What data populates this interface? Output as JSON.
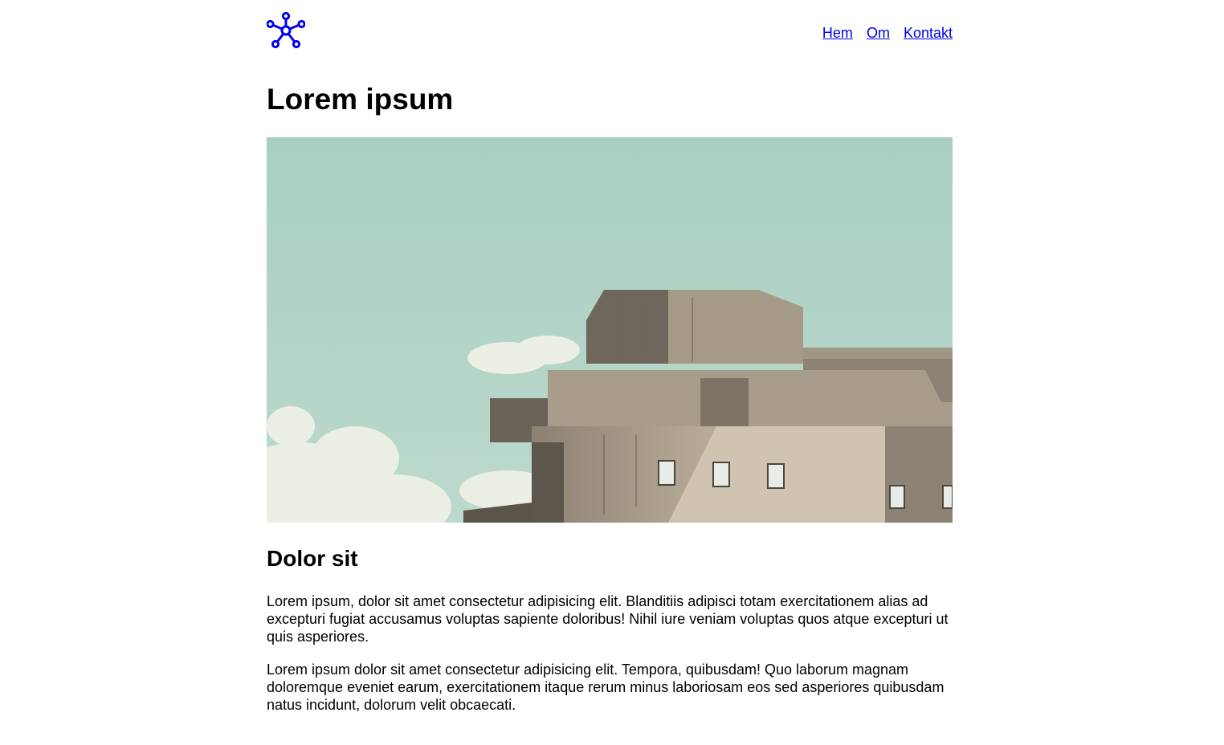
{
  "nav": {
    "items": [
      {
        "label": "Hem"
      },
      {
        "label": "Om"
      },
      {
        "label": "Kontakt"
      }
    ]
  },
  "logo": {
    "icon": "network-molecule-icon",
    "color": "#0000ee"
  },
  "page": {
    "title": "Lorem ipsum",
    "image": {
      "subject": "brutalist-concrete-building-photo"
    },
    "subtitle": "Dolor sit",
    "paragraphs": [
      "Lorem ipsum, dolor sit amet consectetur adipisicing elit. Blanditiis adipisci totam exercitationem alias ad excepturi fugiat accusamus voluptas sapiente doloribus! Nihil iure veniam voluptas quos atque excepturi ut quis asperiores.",
      "Lorem ipsum dolor sit amet consectetur adipisicing elit. Tempora, quibusdam! Quo laborum magnam doloremque eveniet earum, exercitationem itaque rerum minus laboriosam eos sed asperiores quibusdam natus incidunt, dolorum velit obcaecati."
    ]
  },
  "colors": {
    "link": "#0000ee",
    "sky": "#a9d0c3",
    "concrete": "#b3a795"
  }
}
